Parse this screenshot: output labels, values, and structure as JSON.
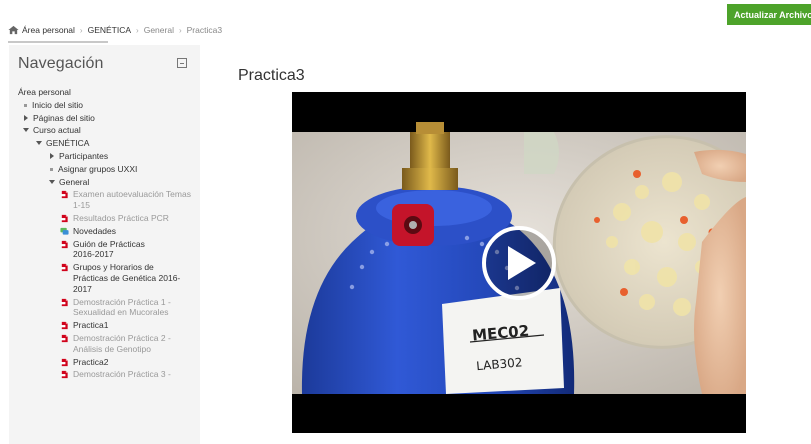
{
  "breadcrumb": {
    "items": [
      "Área personal",
      "GENÉTICA",
      "General",
      "Practica3"
    ]
  },
  "header": {
    "update_button": "Actualizar Archivo"
  },
  "navigation": {
    "title": "Navegación",
    "items": [
      {
        "label": "Área personal"
      },
      {
        "label": "Inicio del sitio"
      },
      {
        "label": "Páginas del sitio"
      },
      {
        "label": "Curso actual"
      },
      {
        "label": "GENÉTICA"
      },
      {
        "label": "Participantes"
      },
      {
        "label": "Asignar grupos UXXI"
      },
      {
        "label": "General"
      },
      {
        "label": "Examen autoevaluación Temas 1-15"
      },
      {
        "label": "Resultados Práctica PCR"
      },
      {
        "label": "Novedades"
      },
      {
        "label": "Guión de Prácticas 2016-2017"
      },
      {
        "label": "Grupos y Horarios de Prácticas de Genética 2016-2017"
      },
      {
        "label": "Demostración Práctica 1 - Sexualidad en Mucorales"
      },
      {
        "label": "Practica1"
      },
      {
        "label": "Demostración Práctica 2 - Análisis de Genotipo"
      },
      {
        "label": "Practica2"
      },
      {
        "label": "Demostración Práctica 3 -"
      }
    ]
  },
  "main": {
    "title": "Practica3",
    "video": {
      "label_top": "MEC02",
      "label_bottom": "LAB302"
    }
  },
  "colors": {
    "accent_green": "#4da32a",
    "file_icon_red": "#d0021b",
    "forum_icon_green": "#5cb85c"
  }
}
